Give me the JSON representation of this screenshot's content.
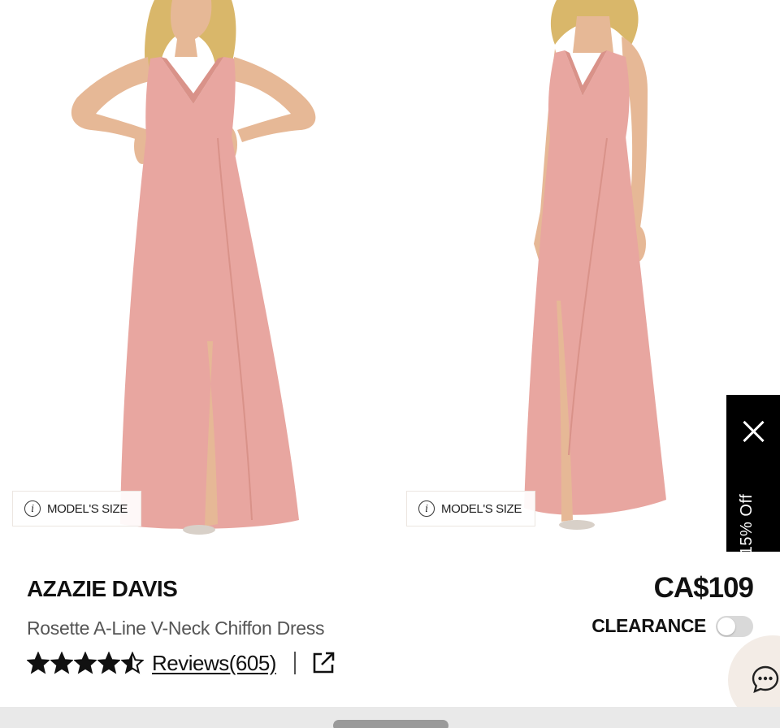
{
  "gallery": {
    "model_size_label_left": "MODEL'S SIZE",
    "model_size_label_right": "MODEL'S SIZE",
    "dress_color": "#e8a6a0",
    "hair_color": "#d9b76a",
    "skin_color": "#e6b896"
  },
  "promo": {
    "text": "15% Off"
  },
  "product": {
    "brand": "AZAZIE DAVIS",
    "name": "Rosette A-Line V-Neck Chiffon Dress",
    "price": "CA$109",
    "clearance_label": "CLEARANCE",
    "clearance_enabled": false,
    "rating": 4.5,
    "reviews_label": "Reviews(605)"
  },
  "icons": {
    "info": "info-icon",
    "close": "close-icon",
    "star": "star-icon",
    "share": "external-link-icon",
    "chat": "chat-icon"
  }
}
